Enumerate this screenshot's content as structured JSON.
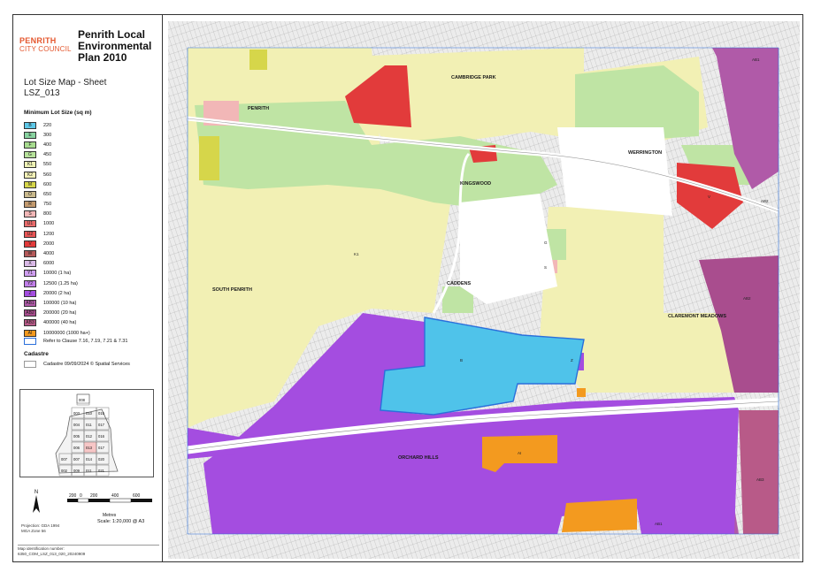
{
  "header": {
    "council_line1": "PENRITH",
    "council_line2": "CITY COUNCIL",
    "title": "Penrith Local Environmental Plan 2010",
    "subtitle": "Lot Size Map - Sheet LSZ_013"
  },
  "legend": {
    "heading": "Minimum Lot Size (sq m)",
    "items": [
      {
        "code": "B",
        "label": "220",
        "color": "#5ec8e8"
      },
      {
        "code": "E",
        "label": "300",
        "color": "#88d3a0"
      },
      {
        "code": "F",
        "label": "400",
        "color": "#a7dc8f"
      },
      {
        "code": "G",
        "label": "450",
        "color": "#b7e39b"
      },
      {
        "code": "K1",
        "label": "550",
        "color": "#eef2b4"
      },
      {
        "code": "K2",
        "label": "560",
        "color": "#f3f1b7"
      },
      {
        "code": "M",
        "label": "600",
        "color": "#d6d64a"
      },
      {
        "code": "O",
        "label": "650",
        "color": "#c9b98c"
      },
      {
        "code": "R",
        "label": "750",
        "color": "#c39a6e"
      },
      {
        "code": "S",
        "label": "800",
        "color": "#f2b7b7"
      },
      {
        "code": "U1",
        "label": "1000",
        "color": "#e86b6b"
      },
      {
        "code": "U2",
        "label": "1200",
        "color": "#e85555"
      },
      {
        "code": "V",
        "label": "2000",
        "color": "#e23b3b"
      },
      {
        "code": "W",
        "label": "4000",
        "color": "#b55a5a"
      },
      {
        "code": "X",
        "label": "6000",
        "color": "#d9b9e6"
      },
      {
        "code": "Y1",
        "label": "10000 (1 ha)",
        "color": "#cf9ef0"
      },
      {
        "code": "Y2",
        "label": "12500 (1.25 ha)",
        "color": "#c07ee8"
      },
      {
        "code": "Z",
        "label": "20000 (2 ha)",
        "color": "#a44de0"
      },
      {
        "code": "AB1",
        "label": "100000 (10 ha)",
        "color": "#b05aa8"
      },
      {
        "code": "AB2",
        "label": "200000 (20 ha)",
        "color": "#a94d8e"
      },
      {
        "code": "AB3",
        "label": "400000 (40 ha)",
        "color": "#b85a88"
      },
      {
        "code": "AI",
        "label": "10000000 (1000 ha+)",
        "color": "#f39a1f"
      }
    ],
    "refer_label": "Refer to Clause 7.16, 7.19, 7.21 & 7.31",
    "cadastre_heading": "Cadastre",
    "cadastre_label": "Cadastre 09/09/2024 © Spatial Services"
  },
  "index_map": {
    "sheets": [
      "008",
      "003",
      "010",
      "015",
      "004",
      "011",
      "017",
      "005",
      "012",
      "016",
      "006",
      "013",
      "017",
      "007",
      "007",
      "014",
      "020",
      "002",
      "009",
      "011",
      "021"
    ]
  },
  "scale": {
    "tick_labels": [
      "200",
      "0",
      "200",
      "400",
      "600"
    ],
    "units": "Metres",
    "text": "Scale: 1:20,000 @ A3",
    "north": "N"
  },
  "projection": {
    "line1": "Projection: GDA 1994",
    "line2": "MGA Zone 56"
  },
  "map_id": {
    "label": "Map identification number:",
    "value": "6350_COM_LSZ_013_020_20240909"
  },
  "places": [
    {
      "name": "PENRITH"
    },
    {
      "name": "CAMBRIDGE PARK"
    },
    {
      "name": "WERRINGTON"
    },
    {
      "name": "KINGSWOOD"
    },
    {
      "name": "SOUTH PENRITH"
    },
    {
      "name": "CADDENS"
    },
    {
      "name": "CLAREMONT MEADOWS"
    },
    {
      "name": "ORCHARD HILLS"
    }
  ],
  "zone_codes": [
    "K1",
    "AB1",
    "AB2",
    "AB3",
    "V",
    "Z",
    "B",
    "AI",
    "G",
    "S",
    "AB2",
    "AB1"
  ]
}
